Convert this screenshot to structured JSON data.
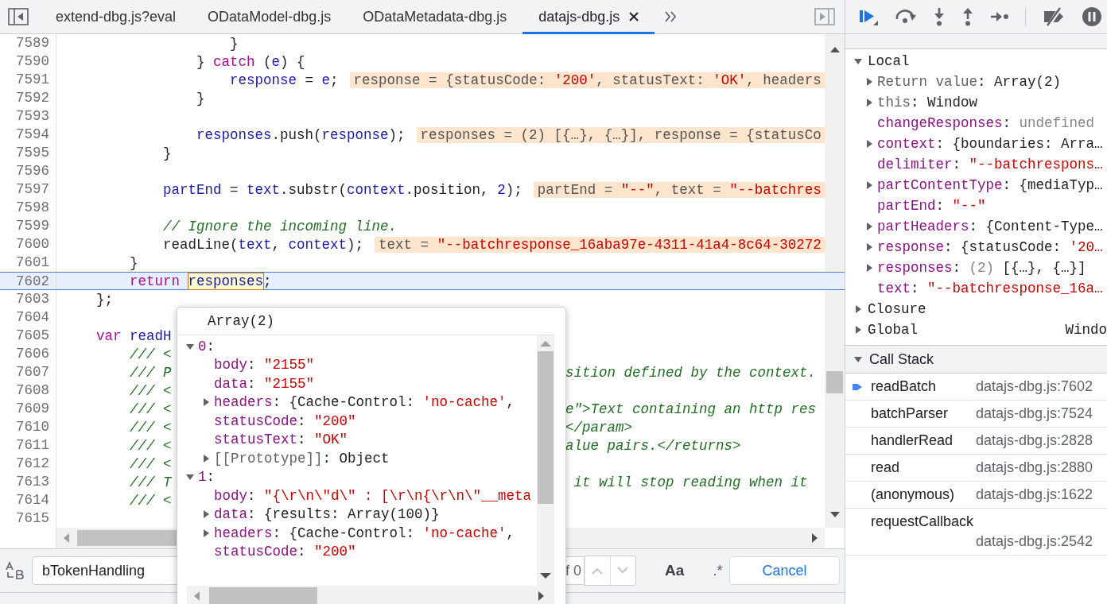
{
  "tabs": [
    {
      "label": "extend-dbg.js?eval",
      "selected": false
    },
    {
      "label": "ODataModel-dbg.js",
      "selected": false
    },
    {
      "label": "ODataMetadata-dbg.js",
      "selected": false
    },
    {
      "label": "datajs-dbg.js",
      "selected": true
    }
  ],
  "code": {
    "lines": [
      {
        "number": "7589",
        "current": false,
        "tokens": [
          {
            "text": "                    }",
            "kind": "plain"
          }
        ]
      },
      {
        "number": "7590",
        "current": false,
        "tokens": [
          {
            "text": "                } ",
            "kind": "plain"
          },
          {
            "text": "catch",
            "kind": "kw"
          },
          {
            "text": " (",
            "kind": "plain"
          },
          {
            "text": "e",
            "kind": "var"
          },
          {
            "text": ") {",
            "kind": "plain"
          }
        ]
      },
      {
        "number": "7591",
        "current": false,
        "tokens": [
          {
            "text": "                    response",
            "kind": "var"
          },
          {
            "text": " = ",
            "kind": "plain"
          },
          {
            "text": "e",
            "kind": "var"
          },
          {
            "text": ";",
            "kind": "plain"
          }
        ],
        "inline_value": [
          {
            "text": "response = {statusCode: ",
            "kind": "dim"
          },
          {
            "text": "'200'",
            "kind": "str"
          },
          {
            "text": ", statusText: ",
            "kind": "dim"
          },
          {
            "text": "'OK'",
            "kind": "str"
          },
          {
            "text": ", headers",
            "kind": "dim"
          }
        ]
      },
      {
        "number": "7592",
        "current": false,
        "tokens": [
          {
            "text": "                }",
            "kind": "plain"
          }
        ]
      },
      {
        "number": "7593",
        "current": false
      },
      {
        "number": "7594",
        "current": false,
        "tokens": [
          {
            "text": "                responses",
            "kind": "var"
          },
          {
            "text": ".push(",
            "kind": "plain"
          },
          {
            "text": "response",
            "kind": "var"
          },
          {
            "text": ");",
            "kind": "plain"
          }
        ],
        "inline_value": [
          {
            "text": "responses = (2) [{…}, {…}], response = {statusCo",
            "kind": "dim"
          }
        ]
      },
      {
        "number": "7595",
        "current": false,
        "tokens": [
          {
            "text": "            }",
            "kind": "plain"
          }
        ]
      },
      {
        "number": "7596",
        "current": false
      },
      {
        "number": "7597",
        "current": false,
        "tokens": [
          {
            "text": "            partEnd",
            "kind": "var"
          },
          {
            "text": " = ",
            "kind": "plain"
          },
          {
            "text": "text",
            "kind": "var"
          },
          {
            "text": ".substr(",
            "kind": "plain"
          },
          {
            "text": "context",
            "kind": "var"
          },
          {
            "text": ".position, ",
            "kind": "plain"
          },
          {
            "text": "2",
            "kind": "num"
          },
          {
            "text": ");",
            "kind": "plain"
          }
        ],
        "inline_value": [
          {
            "text": "partEnd = ",
            "kind": "dim"
          },
          {
            "text": "\"--\"",
            "kind": "str"
          },
          {
            "text": ", text = ",
            "kind": "dim"
          },
          {
            "text": "\"--batchres",
            "kind": "str"
          }
        ]
      },
      {
        "number": "7598",
        "current": false
      },
      {
        "number": "7599",
        "current": false,
        "tokens": [
          {
            "text": "            // Ignore the incoming line.",
            "kind": "comment"
          }
        ]
      },
      {
        "number": "7600",
        "current": false,
        "tokens": [
          {
            "text": "            readLine(",
            "kind": "plain"
          },
          {
            "text": "text",
            "kind": "var"
          },
          {
            "text": ", ",
            "kind": "plain"
          },
          {
            "text": "context",
            "kind": "var"
          },
          {
            "text": ");",
            "kind": "plain"
          }
        ],
        "inline_value": [
          {
            "text": "text = ",
            "kind": "dim"
          },
          {
            "text": "\"--batchresponse_16aba97e-4311-41a4-8c64-30272",
            "kind": "str"
          }
        ]
      },
      {
        "number": "7601",
        "current": false,
        "tokens": [
          {
            "text": "        }",
            "kind": "plain"
          }
        ]
      },
      {
        "number": "7602",
        "current": true,
        "tokens": [
          {
            "text": "        return ",
            "kind": "kw"
          },
          {
            "text": "responses",
            "kind": "hover"
          },
          {
            "text": ";",
            "kind": "plain"
          }
        ]
      },
      {
        "number": "7603",
        "current": false,
        "tokens": [
          {
            "text": "    };",
            "kind": "plain"
          }
        ]
      },
      {
        "number": "7604",
        "current": false
      },
      {
        "number": "7605",
        "current": false,
        "tokens": [
          {
            "text": "    var ",
            "kind": "kw"
          },
          {
            "text": "readH",
            "kind": "var"
          }
        ]
      },
      {
        "number": "7606",
        "current": false,
        "tokens": [
          {
            "text": "        /// <",
            "kind": "comment"
          }
        ]
      },
      {
        "number": "7607",
        "current": false,
        "tokens": [
          {
            "text": "        /// P",
            "kind": "comment"
          }
        ],
        "tail": [
          {
            "text": "sition defined by the context.",
            "kind": "comment"
          }
        ]
      },
      {
        "number": "7608",
        "current": false,
        "tokens": [
          {
            "text": "        /// <",
            "kind": "comment"
          }
        ]
      },
      {
        "number": "7609",
        "current": false,
        "tokens": [
          {
            "text": "        /// <",
            "kind": "comment"
          }
        ],
        "tail": [
          {
            "text": "e\">Text containing an http res",
            "kind": "comment"
          }
        ]
      },
      {
        "number": "7610",
        "current": false,
        "tokens": [
          {
            "text": "        /// <",
            "kind": "comment"
          }
        ],
        "tail": [
          {
            "text": "</param>",
            "kind": "comment"
          }
        ]
      },
      {
        "number": "7611",
        "current": false,
        "tokens": [
          {
            "text": "        /// <",
            "kind": "comment"
          }
        ],
        "tail": [
          {
            "text": "alue pairs.</returns>",
            "kind": "comment"
          }
        ]
      },
      {
        "number": "7612",
        "current": false,
        "tokens": [
          {
            "text": "        /// <",
            "kind": "comment"
          }
        ]
      },
      {
        "number": "7613",
        "current": false,
        "tokens": [
          {
            "text": "        /// T",
            "kind": "comment"
          }
        ],
        "tail": [
          {
            "text": " it will stop reading when it",
            "kind": "comment"
          }
        ]
      },
      {
        "number": "7614",
        "current": false,
        "tokens": [
          {
            "text": "        /// <",
            "kind": "comment"
          }
        ]
      },
      {
        "number": "7615",
        "current": false
      }
    ]
  },
  "popup": {
    "title": "Array(2)",
    "items": [
      {
        "expanded": true,
        "tokens": [
          {
            "text": "0",
            "kind": "key"
          },
          {
            "text": ":",
            "kind": "plain"
          }
        ],
        "children": [
          {
            "tokens": [
              {
                "text": "body",
                "kind": "key"
              },
              {
                "text": ": ",
                "kind": "plain"
              },
              {
                "text": "\"2155\"",
                "kind": "str"
              }
            ]
          },
          {
            "tokens": [
              {
                "text": "data",
                "kind": "key"
              },
              {
                "text": ": ",
                "kind": "plain"
              },
              {
                "text": "\"2155\"",
                "kind": "str"
              }
            ]
          },
          {
            "expanded": false,
            "tokens": [
              {
                "text": "headers",
                "kind": "key"
              },
              {
                "text": ": {Cache-Control: ",
                "kind": "plain"
              },
              {
                "text": "'no-cache'",
                "kind": "str"
              },
              {
                "text": ",",
                "kind": "plain"
              }
            ]
          },
          {
            "tokens": [
              {
                "text": "statusCode",
                "kind": "key"
              },
              {
                "text": ": ",
                "kind": "plain"
              },
              {
                "text": "\"200\"",
                "kind": "str"
              }
            ]
          },
          {
            "tokens": [
              {
                "text": "statusText",
                "kind": "key"
              },
              {
                "text": ": ",
                "kind": "plain"
              },
              {
                "text": "\"OK\"",
                "kind": "str"
              }
            ]
          },
          {
            "expanded": false,
            "tokens": [
              {
                "text": "[[Prototype]]",
                "kind": "internal"
              },
              {
                "text": ": Object",
                "kind": "plain"
              }
            ]
          }
        ]
      },
      {
        "expanded": true,
        "tokens": [
          {
            "text": "1",
            "kind": "key"
          },
          {
            "text": ":",
            "kind": "plain"
          }
        ],
        "children": [
          {
            "tokens": [
              {
                "text": "body",
                "kind": "key"
              },
              {
                "text": ": ",
                "kind": "plain"
              },
              {
                "text": "\"{\\r\\n\\\"d\\\" : [\\r\\n{\\r\\n\\\"__meta",
                "kind": "str"
              }
            ]
          },
          {
            "expanded": false,
            "tokens": [
              {
                "text": "data",
                "kind": "key"
              },
              {
                "text": ": {results: Array(100)}",
                "kind": "plain"
              }
            ]
          },
          {
            "expanded": false,
            "tokens": [
              {
                "text": "headers",
                "kind": "key"
              },
              {
                "text": ": {Cache-Control: ",
                "kind": "plain"
              },
              {
                "text": "'no-cache'",
                "kind": "str"
              },
              {
                "text": ",",
                "kind": "plain"
              }
            ]
          },
          {
            "tokens": [
              {
                "text": "statusCode",
                "kind": "key"
              },
              {
                "text": ": ",
                "kind": "plain"
              },
              {
                "text": "\"200\"",
                "kind": "str"
              }
            ]
          }
        ]
      }
    ]
  },
  "scope": {
    "sections": [
      {
        "title": "Local",
        "expanded": true,
        "items": [
          {
            "expanded": false,
            "tokens": [
              {
                "text": "Return value",
                "kind": "internal"
              },
              {
                "text": ": Array(2)",
                "kind": "plain"
              }
            ]
          },
          {
            "expanded": false,
            "tokens": [
              {
                "text": "this",
                "kind": "internal"
              },
              {
                "text": ": Window",
                "kind": "plain"
              }
            ]
          },
          {
            "tokens": [
              {
                "text": "changeResponses",
                "kind": "key"
              },
              {
                "text": ": ",
                "kind": "plain"
              },
              {
                "text": "undefined",
                "kind": "undef"
              }
            ]
          },
          {
            "expanded": false,
            "tokens": [
              {
                "text": "context",
                "kind": "key"
              },
              {
                "text": ": {boundaries: Arra…",
                "kind": "plain"
              }
            ]
          },
          {
            "tokens": [
              {
                "text": "delimiter",
                "kind": "key"
              },
              {
                "text": ": ",
                "kind": "plain"
              },
              {
                "text": "\"--batchrespons…",
                "kind": "str"
              }
            ]
          },
          {
            "expanded": false,
            "tokens": [
              {
                "text": "partContentType",
                "kind": "key"
              },
              {
                "text": ": {mediaTyp…",
                "kind": "plain"
              }
            ]
          },
          {
            "tokens": [
              {
                "text": "partEnd",
                "kind": "key"
              },
              {
                "text": ": ",
                "kind": "plain"
              },
              {
                "text": "\"--\"",
                "kind": "str"
              }
            ]
          },
          {
            "expanded": false,
            "tokens": [
              {
                "text": "partHeaders",
                "kind": "key"
              },
              {
                "text": ": {Content-Type…",
                "kind": "plain"
              }
            ]
          },
          {
            "expanded": false,
            "tokens": [
              {
                "text": "response",
                "kind": "key"
              },
              {
                "text": ": {statusCode: ",
                "kind": "plain"
              },
              {
                "text": "'20…",
                "kind": "str"
              }
            ]
          },
          {
            "expanded": false,
            "tokens": [
              {
                "text": "responses",
                "kind": "key"
              },
              {
                "text": ": ",
                "kind": "plain"
              },
              {
                "text": "(2)",
                "kind": "undef"
              },
              {
                "text": " [{…}, {…}]",
                "kind": "plain"
              }
            ]
          },
          {
            "tokens": [
              {
                "text": "text",
                "kind": "key"
              },
              {
                "text": ": ",
                "kind": "plain"
              },
              {
                "text": "\"--batchresponse_16a…",
                "kind": "str"
              }
            ]
          }
        ]
      },
      {
        "title": "Closure",
        "expanded": false
      },
      {
        "title": "Global",
        "expanded": false,
        "value": "Windo"
      }
    ]
  },
  "call_stack": {
    "title": "Call Stack",
    "expanded": true,
    "frames": [
      {
        "function": "readBatch",
        "location": "datajs-dbg.js:7602",
        "selected": true
      },
      {
        "function": "batchParser",
        "location": "datajs-dbg.js:7524",
        "selected": false
      },
      {
        "function": "handlerRead",
        "location": "datajs-dbg.js:2828",
        "selected": false
      },
      {
        "function": "read",
        "location": "datajs-dbg.js:2880",
        "selected": false
      },
      {
        "function": "(anonymous)",
        "location": "datajs-dbg.js:1622",
        "selected": false
      },
      {
        "function": "requestCallback",
        "location": "datajs-dbg.js:2542",
        "selected": false
      }
    ]
  },
  "search": {
    "value": "bTokenHandling",
    "count": "f 0",
    "previous_disabled": true,
    "next_disabled": true,
    "case_label": "Aa",
    "regex_label": ".*",
    "cancel_label": "Cancel"
  }
}
